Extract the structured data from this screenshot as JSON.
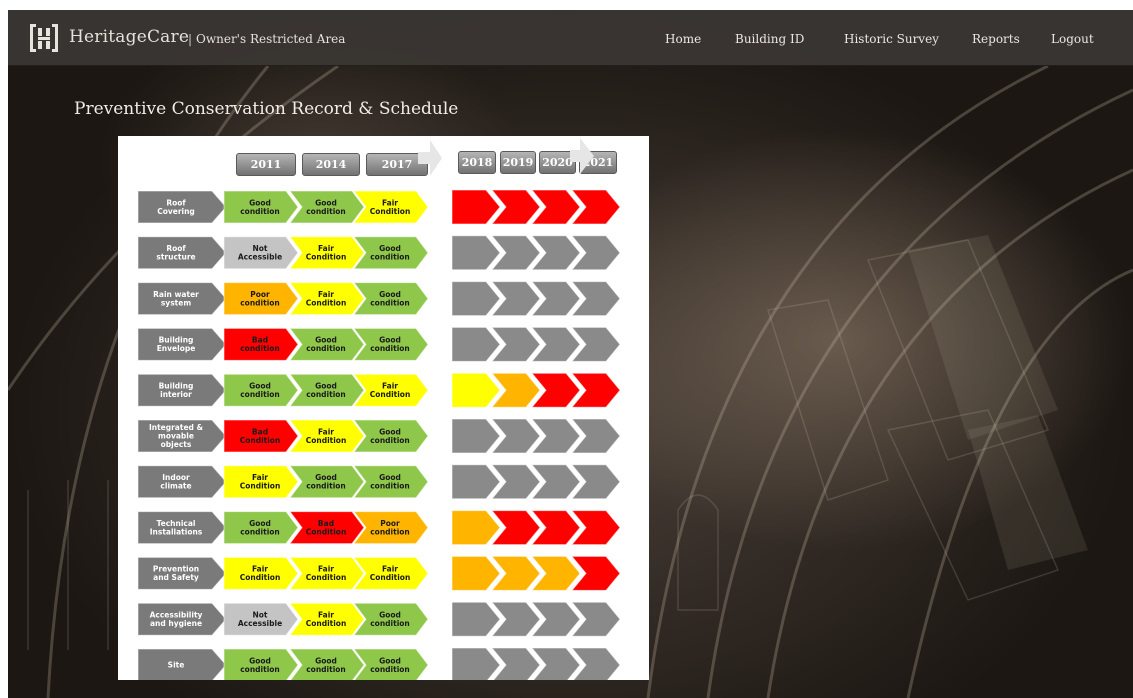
{
  "header": {
    "brand": "HeritageCare",
    "separator": "|",
    "area": "Owner's Restricted Area",
    "nav": [
      {
        "label": "Home"
      },
      {
        "label": "Building ID"
      },
      {
        "label": "Historic Survey"
      },
      {
        "label": "Reports"
      },
      {
        "label": "Logout"
      }
    ]
  },
  "page": {
    "title": "Preventive Conservation Record & Schedule"
  },
  "schedule": {
    "record_years": [
      "2011",
      "2014",
      "2017"
    ],
    "forecast_years": [
      "2018",
      "2019",
      "2020",
      "2021"
    ],
    "colors": {
      "good": "#8fc74a",
      "fair": "#ffff00",
      "poor": "#ffb500",
      "bad": "#ff0000",
      "na": "#c4c4c4",
      "category": "#7a7a7a",
      "unplanned": "#8a8a8a"
    },
    "rows": [
      {
        "category": [
          "Roof",
          "Covering"
        ],
        "record": [
          {
            "s": "good",
            "t": [
              "Good",
              "condition"
            ]
          },
          {
            "s": "good",
            "t": [
              "Good",
              "condition"
            ]
          },
          {
            "s": "fair",
            "t": [
              "Fair",
              "Condition"
            ]
          }
        ],
        "forecast": [
          "bad",
          "bad",
          "bad",
          "bad"
        ]
      },
      {
        "category": [
          "Roof",
          "structure"
        ],
        "record": [
          {
            "s": "na",
            "t": [
              "Not",
              "Accessible"
            ]
          },
          {
            "s": "fair",
            "t": [
              "Fair",
              "Condition"
            ]
          },
          {
            "s": "good",
            "t": [
              "Good",
              "condition"
            ]
          }
        ],
        "forecast": [
          "gray",
          "gray",
          "gray",
          "gray"
        ]
      },
      {
        "category": [
          "Rain water",
          "system"
        ],
        "record": [
          {
            "s": "poor",
            "t": [
              "Poor",
              "condition"
            ]
          },
          {
            "s": "fair",
            "t": [
              "Fair",
              "Condition"
            ]
          },
          {
            "s": "good",
            "t": [
              "Good",
              "condition"
            ]
          }
        ],
        "forecast": [
          "gray",
          "gray",
          "gray",
          "gray"
        ]
      },
      {
        "category": [
          "Building",
          "Envelope"
        ],
        "record": [
          {
            "s": "bad",
            "t": [
              "Bad",
              "condition"
            ]
          },
          {
            "s": "good",
            "t": [
              "Good",
              "condition"
            ]
          },
          {
            "s": "good",
            "t": [
              "Good",
              "condition"
            ]
          }
        ],
        "forecast": [
          "gray",
          "gray",
          "gray",
          "gray"
        ]
      },
      {
        "category": [
          "Building",
          "interior"
        ],
        "record": [
          {
            "s": "good",
            "t": [
              "Good",
              "condition"
            ]
          },
          {
            "s": "good",
            "t": [
              "Good",
              "condition"
            ]
          },
          {
            "s": "fair",
            "t": [
              "Fair",
              "Condition"
            ]
          }
        ],
        "forecast": [
          "fair",
          "poor",
          "bad",
          "bad"
        ]
      },
      {
        "category": [
          "Integrated &",
          "movable",
          "objects"
        ],
        "record": [
          {
            "s": "bad",
            "t": [
              "Bad",
              "Condition"
            ]
          },
          {
            "s": "fair",
            "t": [
              "Fair",
              "Condition"
            ]
          },
          {
            "s": "good",
            "t": [
              "Good",
              "condition"
            ]
          }
        ],
        "forecast": [
          "gray",
          "gray",
          "gray",
          "gray"
        ]
      },
      {
        "category": [
          "Indoor",
          "climate"
        ],
        "record": [
          {
            "s": "fair",
            "t": [
              "Fair",
              "Condition"
            ]
          },
          {
            "s": "good",
            "t": [
              "Good",
              "condition"
            ]
          },
          {
            "s": "good",
            "t": [
              "Good",
              "condition"
            ]
          }
        ],
        "forecast": [
          "gray",
          "gray",
          "gray",
          "gray"
        ]
      },
      {
        "category": [
          "Technical",
          "Installations"
        ],
        "record": [
          {
            "s": "good",
            "t": [
              "Good",
              "condition"
            ]
          },
          {
            "s": "bad",
            "t": [
              "Bad",
              "Condition"
            ]
          },
          {
            "s": "poor",
            "t": [
              "Poor",
              "condition"
            ]
          }
        ],
        "forecast": [
          "poor",
          "bad",
          "bad",
          "bad"
        ]
      },
      {
        "category": [
          "Prevention",
          "and Safety"
        ],
        "record": [
          {
            "s": "fair",
            "t": [
              "Fair",
              "Condition"
            ]
          },
          {
            "s": "fair",
            "t": [
              "Fair",
              "Condition"
            ]
          },
          {
            "s": "fair",
            "t": [
              "Fair",
              "Condition"
            ]
          }
        ],
        "forecast": [
          "poor",
          "poor",
          "poor",
          "bad"
        ]
      },
      {
        "category": [
          "Accessibility",
          "and hygiene"
        ],
        "record": [
          {
            "s": "na",
            "t": [
              "Not",
              "Accessible"
            ]
          },
          {
            "s": "fair",
            "t": [
              "Fair",
              "Condition"
            ]
          },
          {
            "s": "good",
            "t": [
              "Good",
              "condition"
            ]
          }
        ],
        "forecast": [
          "gray",
          "gray",
          "gray",
          "gray"
        ]
      },
      {
        "category": [
          "Site"
        ],
        "record": [
          {
            "s": "good",
            "t": [
              "Good",
              "condition"
            ]
          },
          {
            "s": "good",
            "t": [
              "Good",
              "condition"
            ]
          },
          {
            "s": "good",
            "t": [
              "Good",
              "condition"
            ]
          }
        ],
        "forecast": [
          "gray",
          "gray",
          "gray",
          "gray"
        ]
      }
    ]
  }
}
